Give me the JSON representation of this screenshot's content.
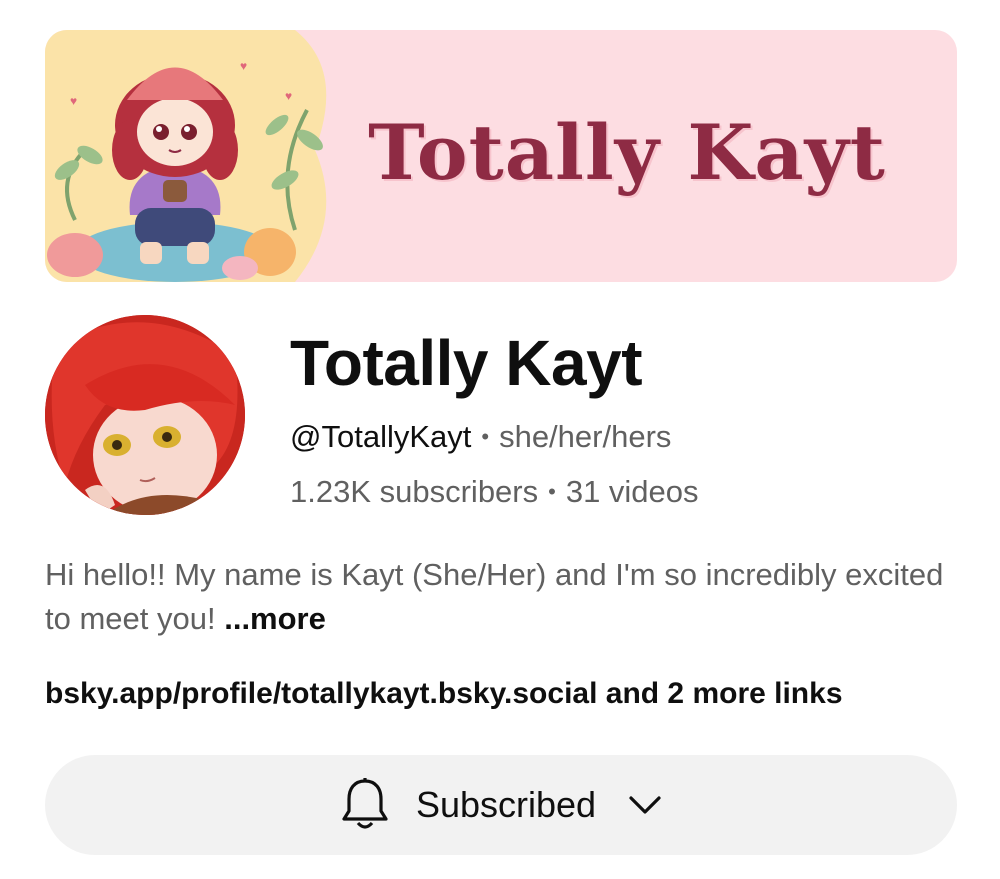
{
  "banner": {
    "title": "Totally Kayt",
    "background": "#fddde2",
    "title_color": "#8e2b44"
  },
  "channel": {
    "name": "Totally Kayt",
    "handle": "@TotallyKayt",
    "pronouns": "she/her/hers",
    "subscribers": "1.23K subscribers",
    "videos": "31 videos",
    "separator": "•"
  },
  "description": {
    "text": "Hi hello!! My name is Kayt (She/Her) and I'm so incredibly excited to meet you! ",
    "more_label": "...more"
  },
  "links": {
    "text": "bsky.app/profile/totallykayt.bsky.social and 2 more links"
  },
  "subscribe": {
    "label": "Subscribed",
    "icon": "bell-icon",
    "dropdown_icon": "chevron-down-icon",
    "background": "#f2f2f2"
  }
}
